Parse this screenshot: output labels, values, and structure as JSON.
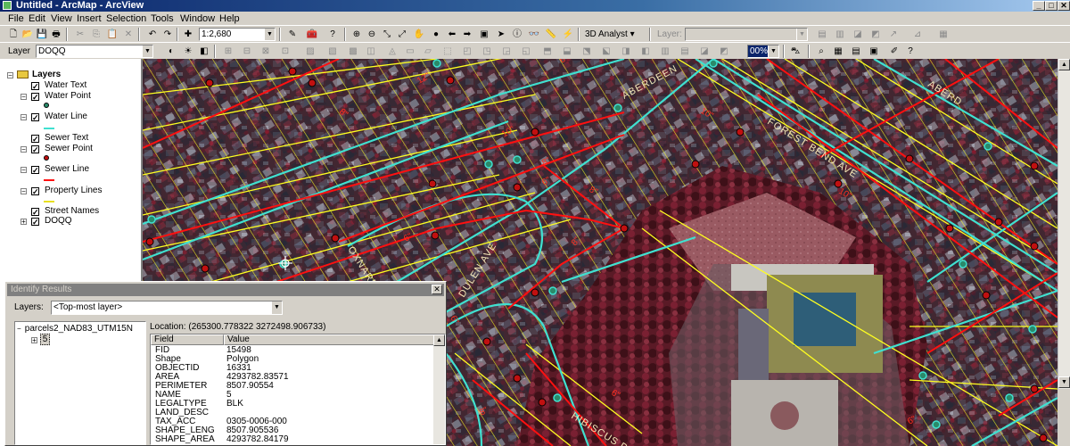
{
  "window": {
    "title": "Untitled - ArcMap - ArcView",
    "min_glyph": "_",
    "max_glyph": "□",
    "close_glyph": "✕"
  },
  "menu": [
    {
      "label": "File"
    },
    {
      "label": "Edit"
    },
    {
      "label": "View"
    },
    {
      "label": "Insert"
    },
    {
      "label": "Selection"
    },
    {
      "label": "Tools"
    },
    {
      "label": "Window"
    },
    {
      "label": "Help"
    }
  ],
  "standard_toolbar": {
    "scale_value": "1:2,680",
    "analyst_label": "3D Analyst ▾",
    "layer_label": "Layer:",
    "layer_value": ""
  },
  "effects_toolbar": {
    "layer_label": "Layer",
    "layer_value": "DOQQ",
    "transparency_value": "00%"
  },
  "toc": {
    "root_label": "Layers",
    "layers": [
      {
        "name": "Water Text",
        "checked": true,
        "symbol": "none"
      },
      {
        "name": "Water Point",
        "checked": true,
        "symbol": "point-green"
      },
      {
        "name": "Water Line",
        "checked": true,
        "symbol": "line-cyan"
      },
      {
        "name": "Sewer Text",
        "checked": true,
        "symbol": "none"
      },
      {
        "name": "Sewer Point",
        "checked": true,
        "symbol": "point-red"
      },
      {
        "name": "Sewer Line",
        "checked": true,
        "symbol": "line-red"
      },
      {
        "name": "Property Lines",
        "checked": true,
        "symbol": "line-yellow"
      },
      {
        "name": "Street Names",
        "checked": true,
        "symbol": "none"
      },
      {
        "name": "DOQQ",
        "checked": true,
        "symbol": "none"
      }
    ]
  },
  "map": {
    "street_labels": [
      "ABERDEEN",
      "FOREST BEND AVE",
      "ABERD",
      "OXNARD",
      "DULEN AVE",
      "HIBISCUS DR"
    ],
    "pipe_labels": [
      "12\"",
      "10\"",
      "8\"",
      "6\"",
      "8\"",
      "6\"",
      "8\"",
      "10\"",
      "6\"",
      "8\"",
      "6\"",
      "10\"",
      "8\"",
      "6\"",
      "6\""
    ]
  },
  "identify": {
    "title": "Identify Results",
    "layers_label": "Layers:",
    "layers_value": "<Top-most layer>",
    "tree_root": "parcels2_NAD83_UTM15N",
    "tree_child": "5",
    "location": "Location: (265300.778322 3272498.906733)",
    "headers": {
      "field": "Field",
      "value": "Value"
    },
    "rows": [
      {
        "field": "FID",
        "value": "15498"
      },
      {
        "field": "Shape",
        "value": "Polygon"
      },
      {
        "field": "OBJECTID",
        "value": "16331"
      },
      {
        "field": "AREA",
        "value": "4293782.83571"
      },
      {
        "field": "PERIMETER",
        "value": "8507.90554"
      },
      {
        "field": "NAME",
        "value": "5"
      },
      {
        "field": "LEGALTYPE",
        "value": "BLK"
      },
      {
        "field": "LAND_DESC",
        "value": ""
      },
      {
        "field": "TAX_ACC",
        "value": "0305-0006-000"
      },
      {
        "field": "SHAPE_LENG",
        "value": "8507.905536"
      },
      {
        "field": "SHAPE_AREA",
        "value": "4293782.84179"
      }
    ]
  },
  "colors": {
    "water_line": "#40e0d0",
    "sewer_line": "#ff1010",
    "property_line": "#ffff20",
    "water_point": "#2a8a6a",
    "sewer_point": "#c01010"
  }
}
